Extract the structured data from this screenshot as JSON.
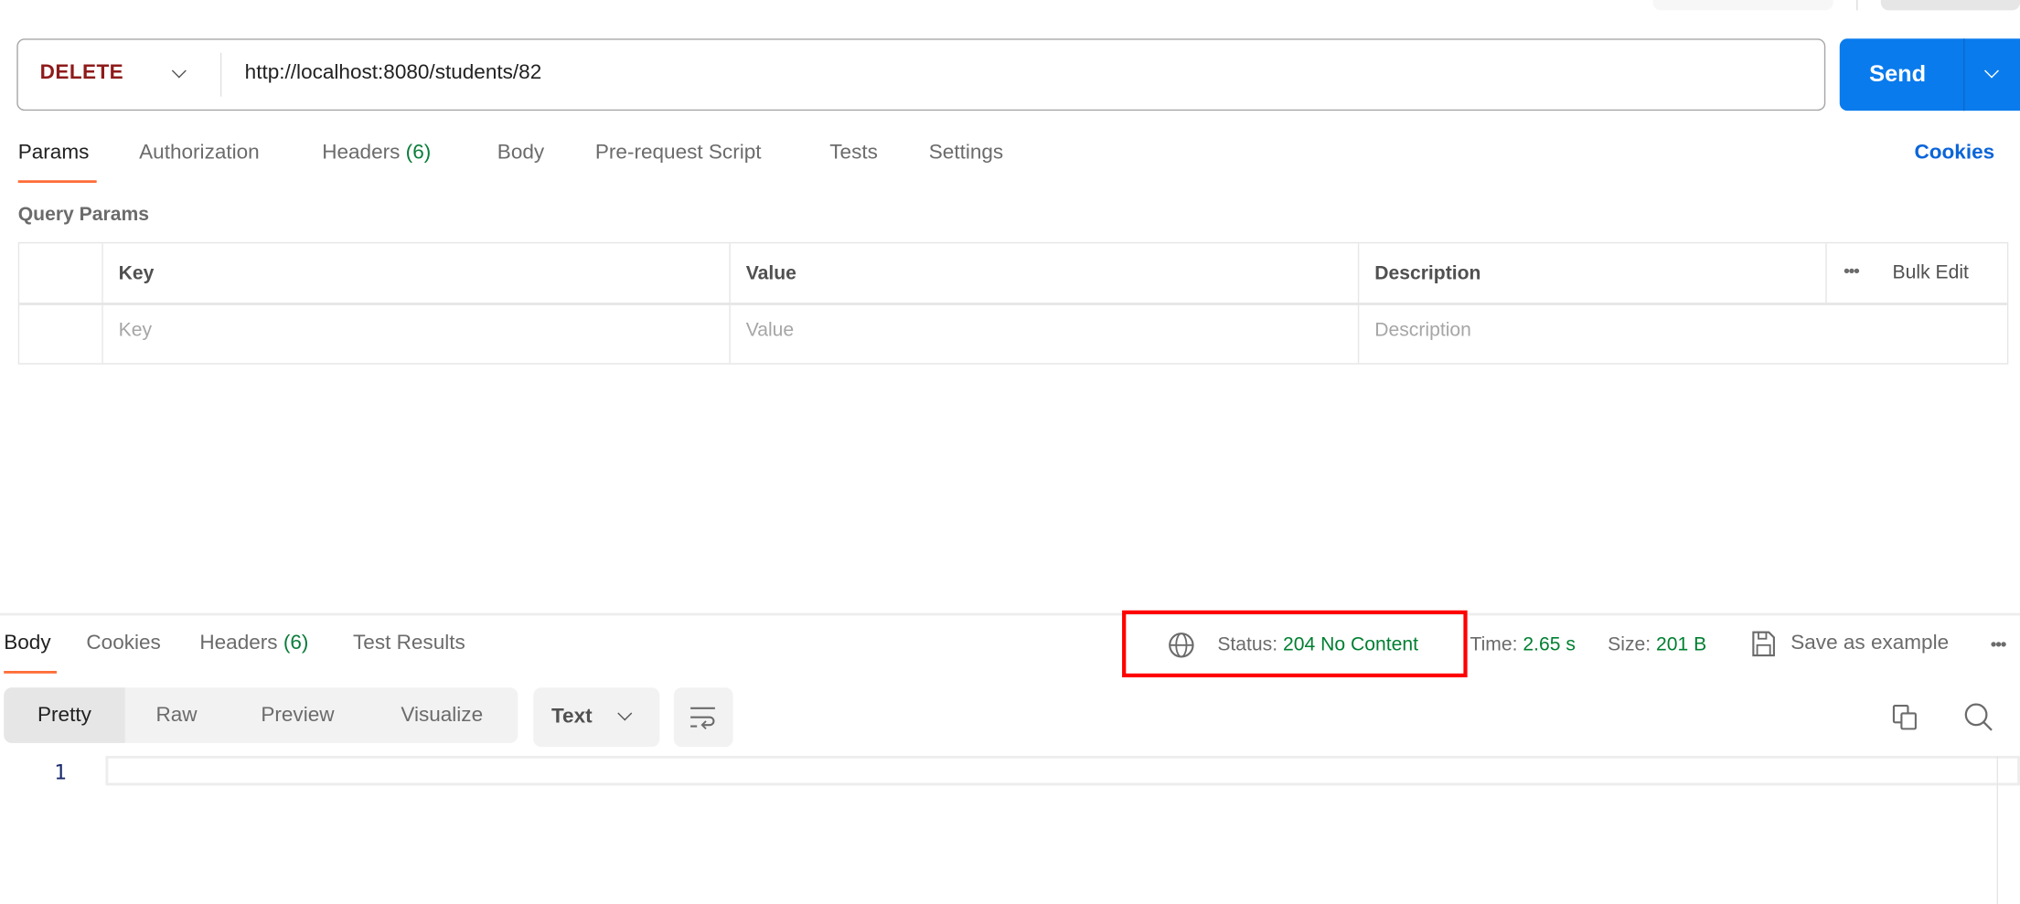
{
  "request": {
    "method": "DELETE",
    "url": "http://localhost:8080/students/82",
    "send_label": "Send"
  },
  "request_tabs": [
    {
      "label": "Params"
    },
    {
      "label": "Authorization"
    },
    {
      "label": "Headers",
      "count": "(6)"
    },
    {
      "label": "Body"
    },
    {
      "label": "Pre-request Script"
    },
    {
      "label": "Tests"
    },
    {
      "label": "Settings"
    }
  ],
  "cookies_link": "Cookies",
  "query_params": {
    "title": "Query Params",
    "columns": [
      "Key",
      "Value",
      "Description"
    ],
    "bulk_edit": "Bulk Edit",
    "placeholders": {
      "key": "Key",
      "value": "Value",
      "description": "Description"
    }
  },
  "response_tabs": [
    {
      "label": "Body"
    },
    {
      "label": "Cookies"
    },
    {
      "label": "Headers",
      "count": "(6)"
    },
    {
      "label": "Test Results"
    }
  ],
  "response_meta": {
    "status_label": "Status:",
    "status_value": "204 No Content",
    "time_label": "Time:",
    "time_value": "2.65 s",
    "size_label": "Size:",
    "size_value": "201 B",
    "save_example": "Save as example"
  },
  "view_modes": [
    "Pretty",
    "Raw",
    "Preview",
    "Visualize"
  ],
  "format": "Text",
  "editor": {
    "line_numbers": [
      "1"
    ]
  },
  "colors": {
    "accent": "#ff6c37",
    "send": "#097bed",
    "status_ok": "#007f31",
    "method_delete": "#8f1a1a",
    "highlight_box": "#ff0000",
    "link": "#0b65d8"
  }
}
